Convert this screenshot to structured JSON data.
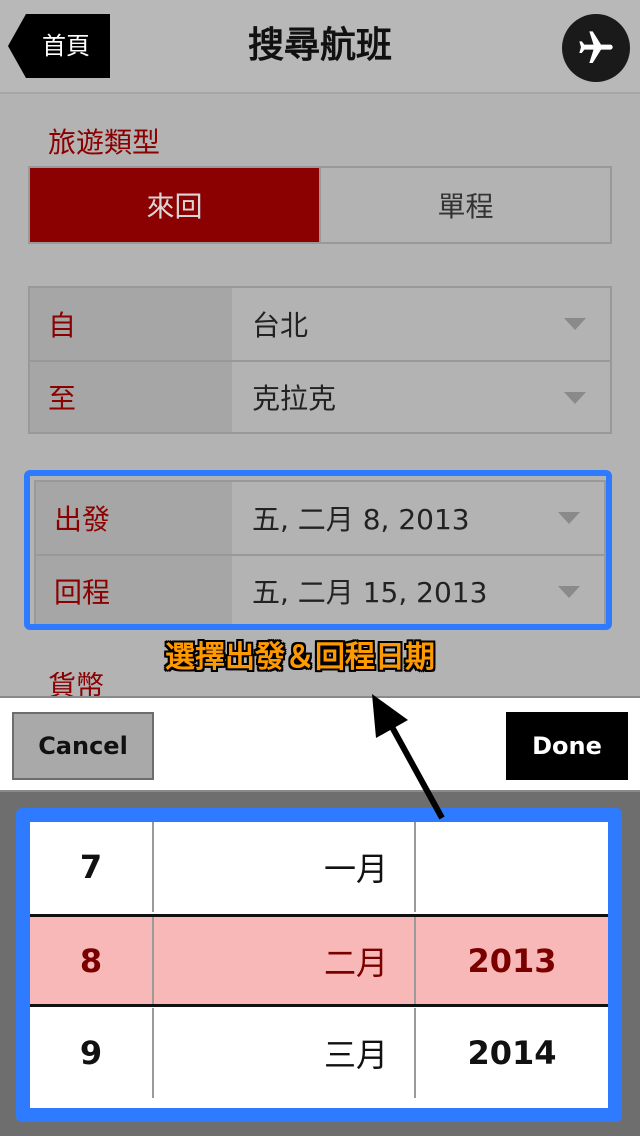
{
  "header": {
    "back_label": "首頁",
    "title": "搜尋航班",
    "plane_icon": "airplane-icon"
  },
  "trip_type": {
    "label": "旅遊類型",
    "options": [
      "來回",
      "單程"
    ],
    "selected": "來回"
  },
  "route": {
    "from_label": "自",
    "from_value": "台北",
    "to_label": "至",
    "to_value": "克拉克"
  },
  "dates": {
    "depart_label": "出發",
    "depart_value": "五, 二月 8, 2013",
    "return_label": "回程",
    "return_value": "五, 二月 15, 2013"
  },
  "annotation": "選擇出發＆回程日期",
  "currency_label": "貨幣",
  "toolbar": {
    "cancel_label": "Cancel",
    "done_label": "Done"
  },
  "picker": {
    "rows": [
      {
        "day": "7",
        "month": "一月",
        "year": ""
      },
      {
        "day": "8",
        "month": "二月",
        "year": "2013"
      },
      {
        "day": "9",
        "month": "三月",
        "year": "2014"
      }
    ]
  },
  "colors": {
    "accent": "#8b0000",
    "highlight": "#2f7bff",
    "annotation": "#ff9900",
    "picker_selected": "#f8b8b8"
  }
}
